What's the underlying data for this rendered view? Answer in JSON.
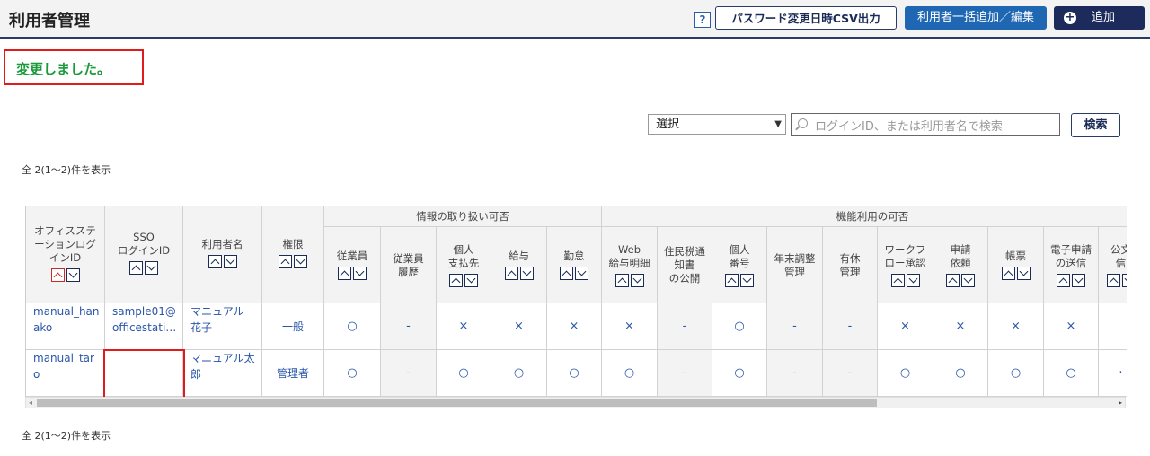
{
  "header": {
    "title": "利用者管理",
    "help_label": "?",
    "csv_button": "パスワード変更日時CSV出力",
    "bulk_button": "利用者一括追加／編集",
    "add_button": "追加",
    "add_icon_glyph": "+"
  },
  "message": "変更しました。",
  "search": {
    "select_value": "選択",
    "placeholder": "ログインID、または利用者名で検索",
    "button": "検索"
  },
  "count_text_top": "全 2(1～2)件を表示",
  "count_text_bottom": "全 2(1～2)件を表示",
  "table": {
    "base_columns": [
      {
        "label_lines": [
          "オフィスステ",
          "ーションログ",
          "インID"
        ],
        "sortable": true,
        "active_sort": "up"
      },
      {
        "label_lines": [
          "SSO",
          "ログインID"
        ],
        "sortable": true
      },
      {
        "label_lines": [
          "利用者名"
        ],
        "sortable": true
      },
      {
        "label_lines": [
          "権限"
        ],
        "sortable": true
      }
    ],
    "groups": [
      {
        "label": "情報の取り扱い可否"
      },
      {
        "label": "機能利用の可否"
      }
    ],
    "sub_columns": [
      {
        "label_lines": [
          "従業員"
        ],
        "sortable": true
      },
      {
        "label_lines": [
          "従業員",
          "履歴"
        ],
        "sortable": false
      },
      {
        "label_lines": [
          "個人",
          "支払先"
        ],
        "sortable": true
      },
      {
        "label_lines": [
          "給与"
        ],
        "sortable": true
      },
      {
        "label_lines": [
          "勤怠"
        ],
        "sortable": true
      },
      {
        "label_lines": [
          "Web",
          "給与明細"
        ],
        "sortable": true
      },
      {
        "label_lines": [
          "住民税通",
          "知書",
          "の公開"
        ],
        "sortable": false
      },
      {
        "label_lines": [
          "個人",
          "番号"
        ],
        "sortable": true
      },
      {
        "label_lines": [
          "年末調整",
          "管理"
        ],
        "sortable": false
      },
      {
        "label_lines": [
          "有休",
          "管理"
        ],
        "sortable": false
      },
      {
        "label_lines": [
          "ワークフ",
          "ロー承認"
        ],
        "sortable": true
      },
      {
        "label_lines": [
          "申請",
          "依頼"
        ],
        "sortable": true
      },
      {
        "label_lines": [
          "帳票"
        ],
        "sortable": true
      },
      {
        "label_lines": [
          "電子申請",
          "の送信"
        ],
        "sortable": true
      },
      {
        "label_lines": [
          "公文",
          "信"
        ],
        "sortable": true
      }
    ],
    "rows": [
      {
        "login_id": [
          "manual_han",
          "ako"
        ],
        "sso_id": [
          "sample01@",
          "officestati…"
        ],
        "name": [
          "マニュアル",
          "花子"
        ],
        "role": "一般",
        "values": [
          "○",
          "-",
          "×",
          "×",
          "×",
          "×",
          "-",
          "○",
          "-",
          "-",
          "×",
          "×",
          "×",
          "×",
          ""
        ]
      },
      {
        "login_id": [
          "manual_tar",
          "o"
        ],
        "sso_id": [
          "",
          ""
        ],
        "name": [
          "マニュアル太",
          "郎"
        ],
        "role": "管理者",
        "values": [
          "○",
          "-",
          "○",
          "○",
          "○",
          "○",
          "-",
          "○",
          "-",
          "-",
          "○",
          "○",
          "○",
          "○",
          "·"
        ]
      }
    ]
  },
  "scrollbar": {
    "left_arrow": "◂",
    "right_arrow": "▸"
  }
}
